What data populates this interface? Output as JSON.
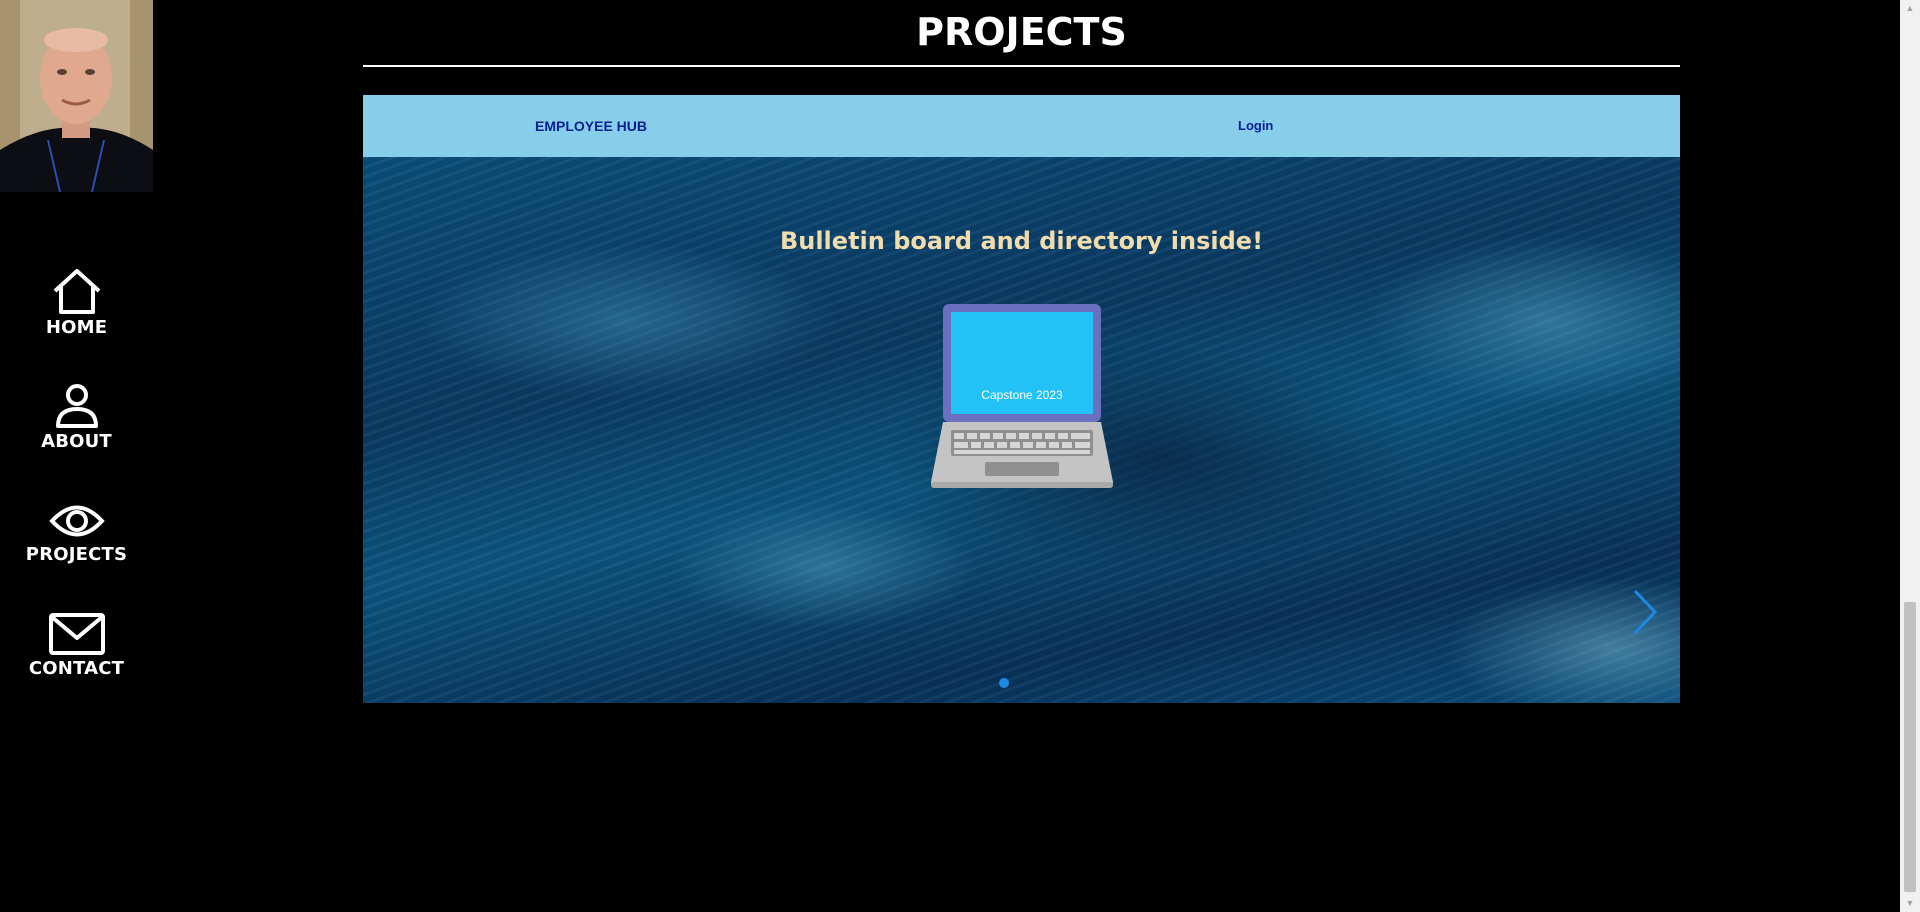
{
  "sidebar": {
    "items": [
      {
        "label": "HOME",
        "icon": "home-icon"
      },
      {
        "label": "ABOUT",
        "icon": "person-icon"
      },
      {
        "label": "PROJECTS",
        "icon": "eye-icon"
      },
      {
        "label": "CONTACT",
        "icon": "envelope-icon"
      }
    ]
  },
  "main": {
    "title": "PROJECTS",
    "project": {
      "nav": {
        "brand": "EMPLOYEE HUB",
        "login": "Login"
      },
      "hero_heading": "Bulletin board and directory inside!",
      "laptop_caption": "Capstone 2023"
    }
  },
  "colors": {
    "background": "#000000",
    "project_nav": "#87ceeb",
    "nav_link": "#0a1f8f",
    "hero_heading": "#f1dcae",
    "carousel_accent": "#1e88e5"
  }
}
